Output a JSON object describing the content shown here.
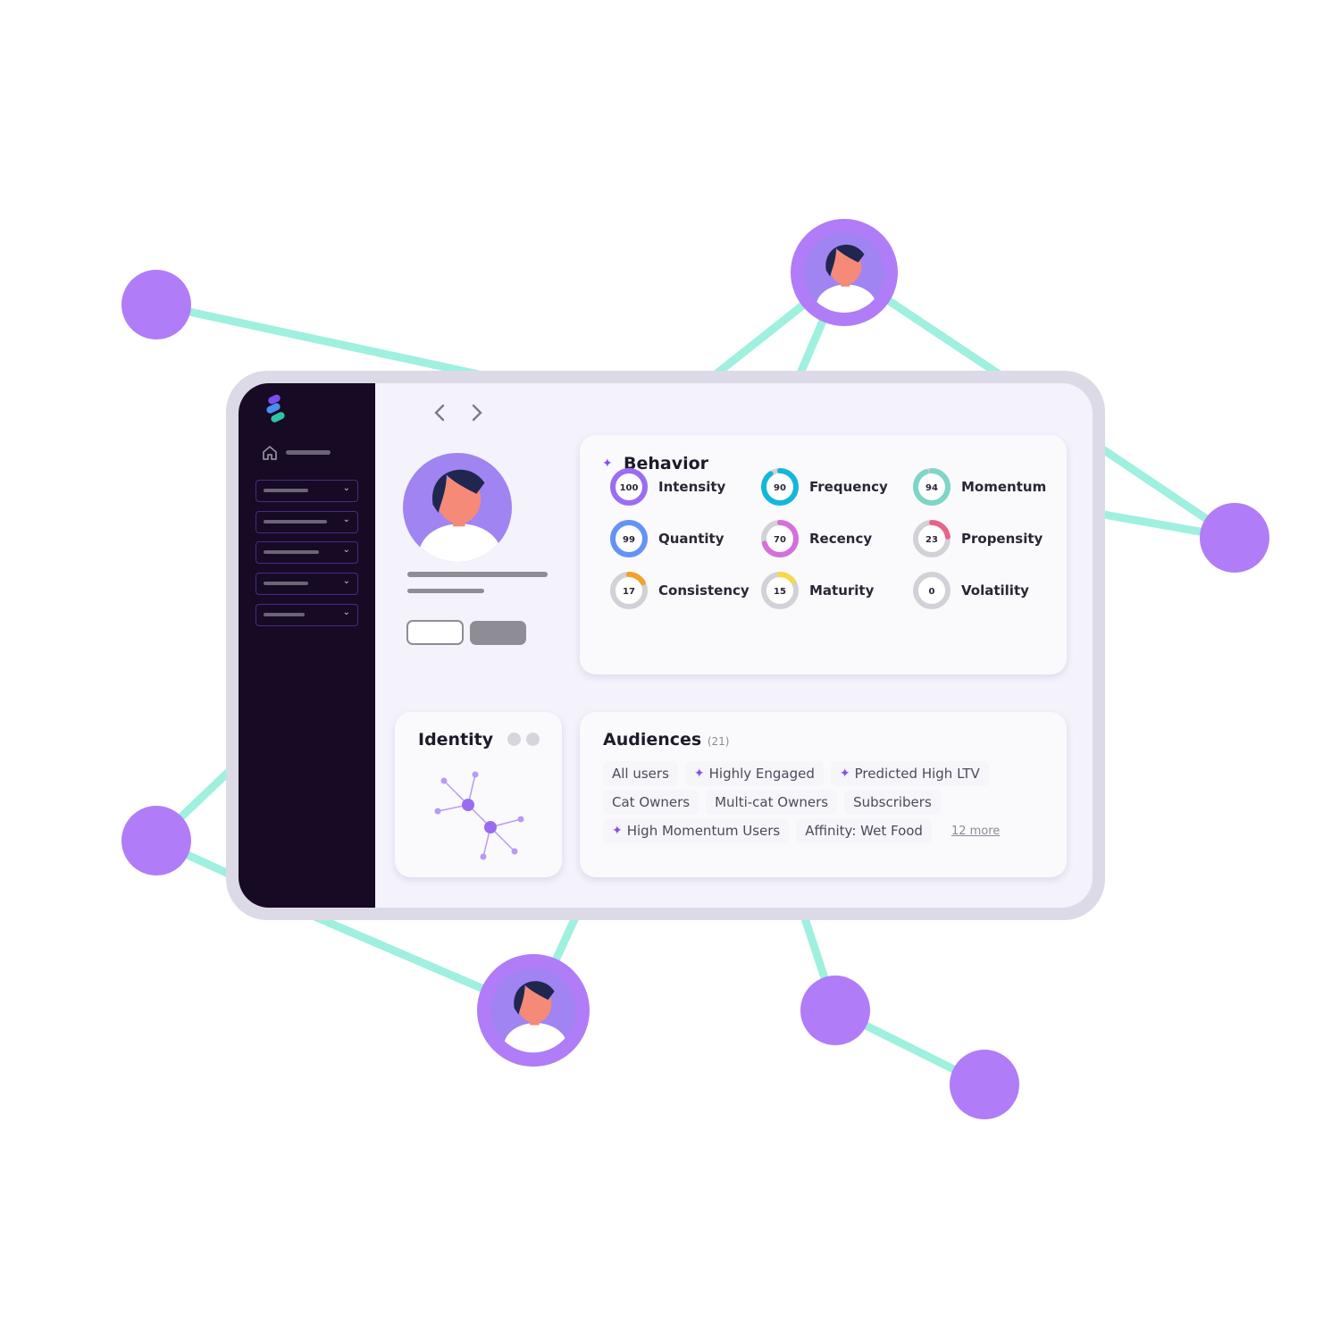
{
  "colors": {
    "node": "#b07cf7",
    "link": "#9ff0de",
    "sidebar": "#170a24",
    "accent": "#8a4ee8"
  },
  "nav": {
    "back_icon": "chevron-left",
    "forward_icon": "chevron-right"
  },
  "behavior": {
    "title": "Behavior",
    "metrics": [
      {
        "label": "Intensity",
        "value": 100,
        "color": "#9c6cf5"
      },
      {
        "label": "Frequency",
        "value": 90,
        "color": "#14b7dc"
      },
      {
        "label": "Momentum",
        "value": 94,
        "color": "#7dd6c6"
      },
      {
        "label": "Quantity",
        "value": 99,
        "color": "#6592f5"
      },
      {
        "label": "Recency",
        "value": 70,
        "color": "#d66fdc"
      },
      {
        "label": "Propensity",
        "value": 23,
        "color": "#e6648a"
      },
      {
        "label": "Consistency",
        "value": 17,
        "color": "#f3a227"
      },
      {
        "label": "Maturity",
        "value": 15,
        "color": "#f8d84a"
      },
      {
        "label": "Volatility",
        "value": 0,
        "color": "#cfcfd6"
      }
    ]
  },
  "identity": {
    "title": "Identity"
  },
  "audiences": {
    "title": "Audiences",
    "count": "(21)",
    "rows": [
      [
        {
          "label": "All users",
          "ai": false
        },
        {
          "label": "Highly Engaged",
          "ai": true
        },
        {
          "label": "Predicted High LTV",
          "ai": true
        }
      ],
      [
        {
          "label": "Cat Owners",
          "ai": false
        },
        {
          "label": "Multi-cat Owners",
          "ai": false
        },
        {
          "label": "Subscribers",
          "ai": false
        }
      ],
      [
        {
          "label": "High Momentum Users",
          "ai": true
        },
        {
          "label": "Affinity: Wet Food",
          "ai": false
        }
      ]
    ],
    "more": "12 more"
  }
}
